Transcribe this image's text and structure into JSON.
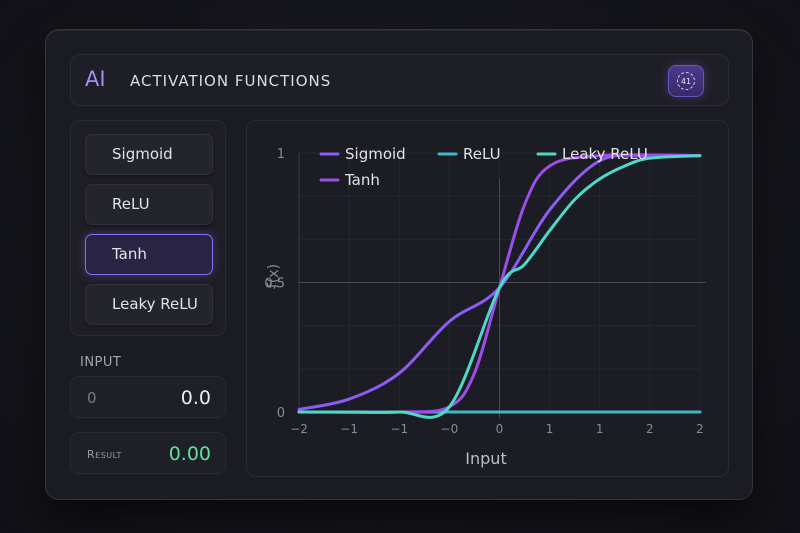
{
  "header": {
    "logo": "AI",
    "title": "ACTIVATION FUNCTIONS",
    "badge": "41"
  },
  "functions": [
    {
      "label": "Sigmoid",
      "active": false
    },
    {
      "label": "ReLU",
      "active": false
    },
    {
      "label": "Tanh",
      "active": true
    },
    {
      "label": "Leaky ReLU",
      "active": false
    }
  ],
  "input": {
    "label": "INPUT",
    "placeholder": "0",
    "value": "0.0"
  },
  "result": {
    "label": "Result",
    "value": "0.00"
  },
  "chart_data": {
    "type": "line",
    "xlabel": "Input",
    "ylabel": "f(x)",
    "x_ticks": [
      "−2",
      "−1",
      "−1",
      "−0",
      "0",
      "1",
      "1",
      "2",
      "2"
    ],
    "y_ticks": [
      "0",
      "0,5",
      "1"
    ],
    "xlim": [
      -2,
      2
    ],
    "ylim": [
      0,
      1
    ],
    "grid": true,
    "legend_position": "top",
    "series": [
      {
        "name": "Sigmoid",
        "color": "#8b5cf6",
        "x": [
          -2,
          -1.5,
          -1,
          -0.5,
          0,
          0.5,
          1,
          1.5,
          2
        ],
        "y": [
          0.01,
          0.05,
          0.15,
          0.35,
          0.48,
          0.78,
          0.97,
          0.99,
          0.99
        ]
      },
      {
        "name": "ReLU",
        "color": "#3fb8c8",
        "x": [
          -2,
          -1,
          0,
          1,
          2
        ],
        "y": [
          0.0,
          0.0,
          0.0,
          0.0,
          0.0
        ]
      },
      {
        "name": "Leaky ReLU",
        "color": "#4fd8c8",
        "x": [
          -2,
          -1.5,
          -1,
          -0.5,
          0,
          0.25,
          0.5,
          0.75,
          1,
          1.25,
          1.5,
          2
        ],
        "y": [
          0.0,
          0.0,
          0.0,
          0.02,
          0.48,
          0.57,
          0.7,
          0.82,
          0.9,
          0.95,
          0.98,
          0.99
        ]
      },
      {
        "name": "Tanh",
        "color": "#9d4ee6",
        "x": [
          -2,
          -1,
          -0.5,
          -0.25,
          0,
          0.25,
          0.5,
          1,
          2
        ],
        "y": [
          0.0,
          0.0,
          0.02,
          0.15,
          0.48,
          0.8,
          0.95,
          0.99,
          0.99
        ]
      }
    ]
  }
}
